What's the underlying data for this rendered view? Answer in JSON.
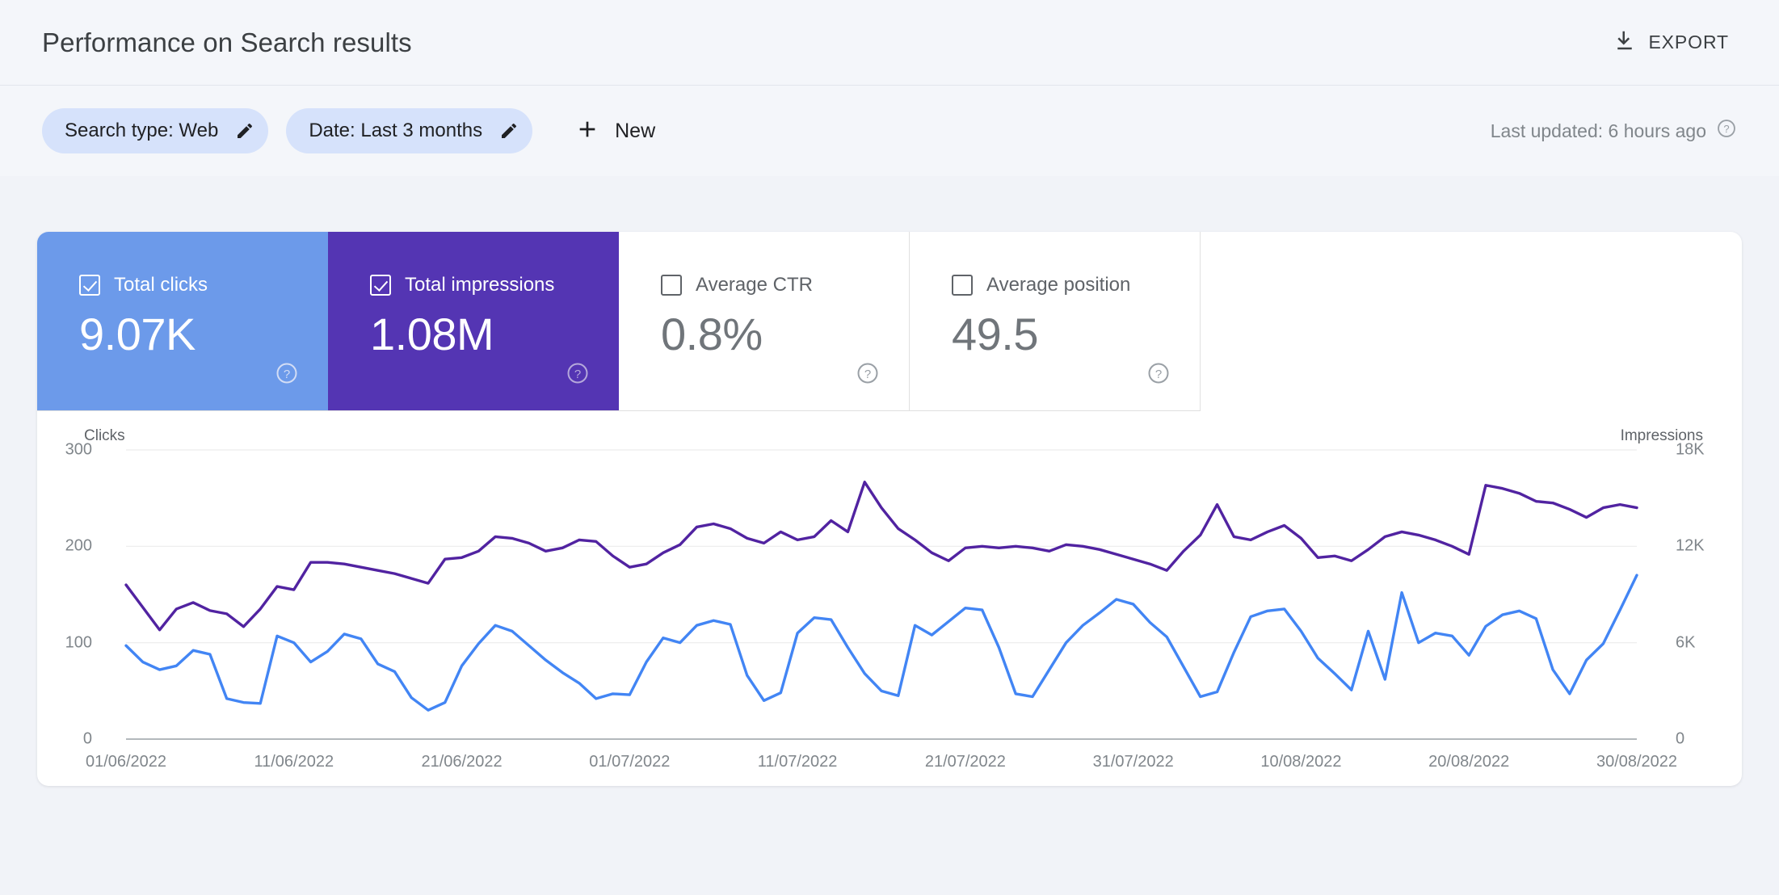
{
  "header": {
    "title": "Performance on Search results",
    "export_label": "EXPORT",
    "export_icon": "download-icon"
  },
  "filters": {
    "chips": [
      {
        "label": "Search type: Web",
        "icon": "pencil-icon"
      },
      {
        "label": "Date: Last 3 months",
        "icon": "pencil-icon"
      }
    ],
    "new_label": "New",
    "new_icon": "plus-icon",
    "last_updated": "Last updated: 6 hours ago",
    "help_icon": "help-circle-icon"
  },
  "metrics": [
    {
      "name": "Total clicks",
      "value": "9.07K",
      "checked": true,
      "style": "blue",
      "color": "#6c9aea",
      "help_icon": "help-circle-icon"
    },
    {
      "name": "Total impressions",
      "value": "1.08M",
      "checked": true,
      "style": "purple",
      "color": "#5435b3",
      "help_icon": "help-circle-icon"
    },
    {
      "name": "Average CTR",
      "value": "0.8%",
      "checked": false,
      "style": "plain",
      "color": "#ffffff",
      "help_icon": "help-circle-icon"
    },
    {
      "name": "Average position",
      "value": "49.5",
      "checked": false,
      "style": "plain",
      "color": "#ffffff",
      "help_icon": "help-circle-icon"
    }
  ],
  "chart_data": {
    "type": "line",
    "title": "",
    "xlabel": "",
    "ylabel": "Clicks",
    "y2label": "Impressions",
    "grid": true,
    "legend": "none",
    "ylim": [
      0,
      300
    ],
    "y2lim": [
      0,
      18000
    ],
    "yticks": [
      "0",
      "100",
      "200",
      "300"
    ],
    "ytick_values": [
      0,
      100,
      200,
      300
    ],
    "y2ticks": [
      "0",
      "6K",
      "12K",
      "18K"
    ],
    "y2tick_values": [
      0,
      6000,
      12000,
      18000
    ],
    "xticks": [
      "01/06/2022",
      "11/06/2022",
      "21/06/2022",
      "01/07/2022",
      "11/07/2022",
      "21/07/2022",
      "31/07/2022",
      "10/08/2022",
      "20/08/2022",
      "30/08/2022"
    ],
    "xtick_indices": [
      0,
      10,
      20,
      30,
      40,
      50,
      60,
      70,
      80,
      90
    ],
    "x_start": "01/06/2022",
    "x_end": "30/08/2022",
    "series": [
      {
        "name": "Clicks",
        "axis": "left",
        "color": "#4285f4",
        "values": [
          97,
          80,
          72,
          76,
          92,
          88,
          42,
          38,
          37,
          107,
          100,
          80,
          91,
          109,
          104,
          78,
          70,
          43,
          30,
          38,
          76,
          99,
          118,
          112,
          97,
          82,
          69,
          58,
          42,
          47,
          46,
          80,
          105,
          100,
          118,
          123,
          119,
          66,
          40,
          48,
          110,
          126,
          124,
          95,
          68,
          50,
          45,
          118,
          108,
          122,
          136,
          134,
          95,
          47,
          44,
          72,
          100,
          118,
          131,
          145,
          140,
          121,
          106,
          75,
          44,
          49,
          90,
          127,
          133,
          135,
          112,
          84,
          68,
          51,
          112,
          62,
          152,
          100,
          110,
          107,
          87,
          117,
          129,
          133,
          125,
          72,
          47,
          82,
          99,
          134,
          170
        ]
      },
      {
        "name": "Impressions",
        "axis": "right",
        "color": "#5123a1",
        "values": [
          9600,
          8200,
          6800,
          8100,
          8500,
          8000,
          7800,
          7000,
          8100,
          9500,
          9300,
          11000,
          11000,
          10900,
          10700,
          10500,
          10300,
          10000,
          9700,
          11200,
          11300,
          11700,
          12600,
          12500,
          12200,
          11700,
          11900,
          12400,
          12300,
          11400,
          10700,
          10900,
          11600,
          12100,
          13200,
          13400,
          13100,
          12500,
          12200,
          12900,
          12400,
          12600,
          13600,
          12900,
          16000,
          14400,
          13100,
          12400,
          11600,
          11100,
          11900,
          12000,
          11900,
          12000,
          11900,
          11700,
          12100,
          12000,
          11800,
          11500,
          11200,
          10900,
          10500,
          11700,
          12700,
          14600,
          12600,
          12400,
          12900,
          13300,
          12500,
          11300,
          11400,
          11100,
          11800,
          12600,
          12900,
          12700,
          12400,
          12000,
          11500,
          15800,
          15600,
          15300,
          14800,
          14700,
          14300,
          13800,
          14400,
          14600,
          14400
        ]
      }
    ]
  }
}
